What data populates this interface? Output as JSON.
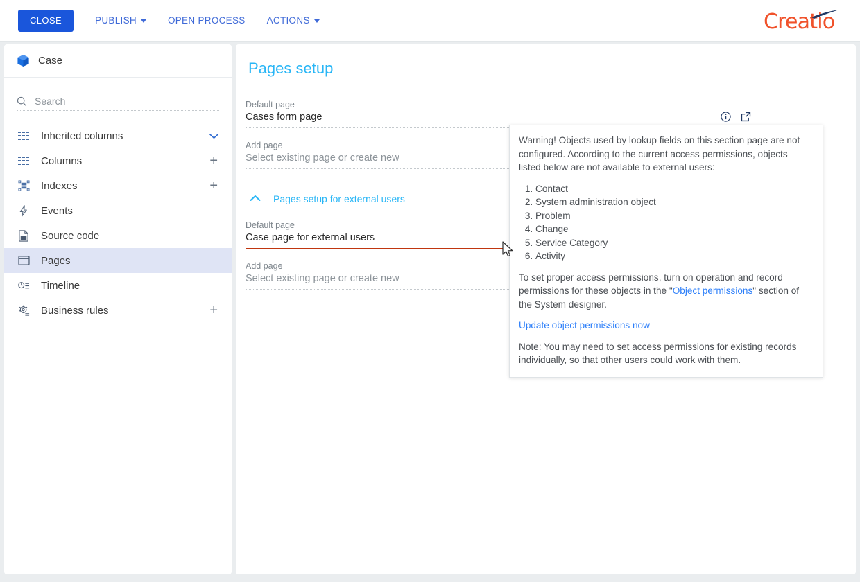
{
  "toolbar": {
    "close_label": "CLOSE",
    "publish_label": "PUBLISH",
    "open_process_label": "OPEN PROCESS",
    "actions_label": "ACTIONS",
    "logo_text": "Creatio",
    "accent_blue": "#1a56db",
    "link_blue": "#3f6ad8",
    "logo_orange": "#f0522b",
    "logo_navy": "#1f3864"
  },
  "sidebar": {
    "header": {
      "label": "Case",
      "icon": "cube-icon"
    },
    "search": {
      "placeholder": "Search",
      "value": "",
      "icon": "search-icon"
    },
    "items": [
      {
        "label": "Inherited columns",
        "icon": "columns-icon",
        "action": "chevron-down-icon",
        "active": false
      },
      {
        "label": "Columns",
        "icon": "columns-icon",
        "action": "plus-icon",
        "active": false
      },
      {
        "label": "Indexes",
        "icon": "indexes-icon",
        "action": "plus-icon",
        "active": false
      },
      {
        "label": "Events",
        "icon": "lightning-icon",
        "action": "",
        "active": false
      },
      {
        "label": "Source code",
        "icon": "source-code-icon",
        "action": "",
        "active": false
      },
      {
        "label": "Pages",
        "icon": "page-window-icon",
        "action": "",
        "active": true
      },
      {
        "label": "Timeline",
        "icon": "timeline-icon",
        "action": "",
        "active": false
      },
      {
        "label": "Business rules",
        "icon": "gear-rules-icon",
        "action": "plus-icon",
        "active": false
      }
    ]
  },
  "main": {
    "title": "Pages setup",
    "fields": [
      {
        "label": "Default page",
        "value": "Cases form page",
        "is_placeholder": false,
        "error": false,
        "icons": [
          "info-icon",
          "external-link-icon"
        ]
      },
      {
        "label": "Add page",
        "value": "Select existing page or create new",
        "is_placeholder": true,
        "error": false,
        "icons": [
          "info-icon"
        ]
      }
    ],
    "collapse_section": {
      "label": "Pages setup for external users",
      "icon": "chevron-up-icon",
      "expanded": true
    },
    "external_fields": [
      {
        "label": "Default page",
        "value": "Case page for external users",
        "is_placeholder": false,
        "error": true,
        "error_color": "#c0360f",
        "controls": [
          "clear-icon",
          "dropdown-arrow-icon",
          "info-icon-error"
        ]
      },
      {
        "label": "Add page",
        "value": "Select existing page or create new",
        "is_placeholder": true,
        "error": false,
        "icons": [
          "info-icon"
        ]
      }
    ]
  },
  "tooltip": {
    "paragraph_1": "Warning! Objects used by lookup fields on this section page are not configured. According to the current access permissions, objects listed below are not available to external users:",
    "object_list": [
      "Contact",
      "System administration object",
      "Problem",
      "Change",
      "Service Category",
      "Activity"
    ],
    "paragraph_2_part1": "To set proper access permissions, turn on operation and record permissions for these objects in the \"",
    "paragraph_2_link": "Object permissions",
    "paragraph_2_part2": "\" section of the System designer.",
    "action_link": "Update object permissions now",
    "note": "Note: You may need to set access permissions for existing records individually, so that other users could work with them."
  }
}
